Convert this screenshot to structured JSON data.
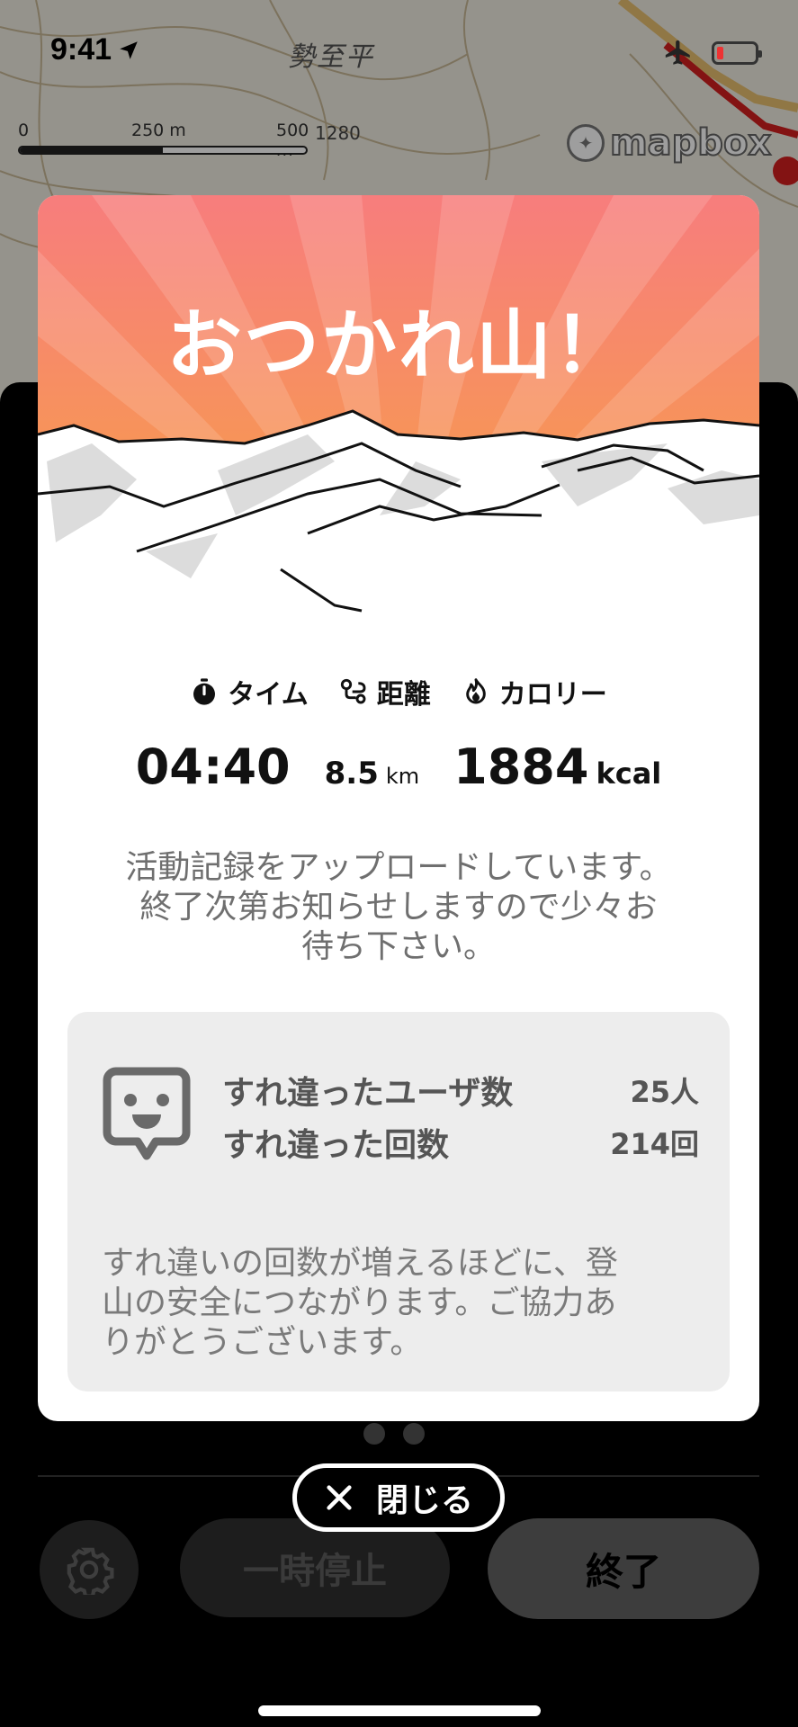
{
  "status_bar": {
    "time": "9:41"
  },
  "map": {
    "place_label": "勢至平",
    "scale": {
      "zero": "0",
      "mid": "250 m",
      "end": "500 m"
    },
    "elevation_label": "1280",
    "attribution": "mapbox"
  },
  "card": {
    "title": "おつかれ山！",
    "stats": {
      "time_label": "タイム",
      "distance_label": "距離",
      "calorie_label": "カロリー",
      "time_value": "04:40",
      "distance_value": "8.5",
      "distance_unit": "km",
      "calorie_value": "1884",
      "calorie_unit": "kcal"
    },
    "upload_message_lines": [
      "活動記録をアップロードしています。",
      "終了次第お知らせしますので少々お",
      "待ち下さい。"
    ],
    "pass_by": {
      "users_label": "すれ違ったユーザ数",
      "users_value": "25人",
      "count_label": "すれ違った回数",
      "count_value": "214回",
      "note_lines": [
        "すれ違いの回数が増えるほどに、登",
        "山の安全につながります。ご協力あ",
        "りがとうございます。"
      ]
    }
  },
  "close_button": {
    "label": "閉じる"
  },
  "controls": {
    "pause_label": "一時停止",
    "end_label": "終了"
  },
  "icons": {
    "location_arrow": "location-arrow-icon",
    "airplane": "airplane-icon",
    "battery": "battery-icon",
    "stopwatch": "stopwatch-icon",
    "route": "route-icon",
    "flame": "flame-icon",
    "face": "smiley-face-icon",
    "close": "close-x-icon",
    "gear": "gear-icon"
  },
  "colors": {
    "hero_top": "#f77d7d",
    "hero_bottom": "#f6a23c",
    "battery_low": "#e33333"
  }
}
